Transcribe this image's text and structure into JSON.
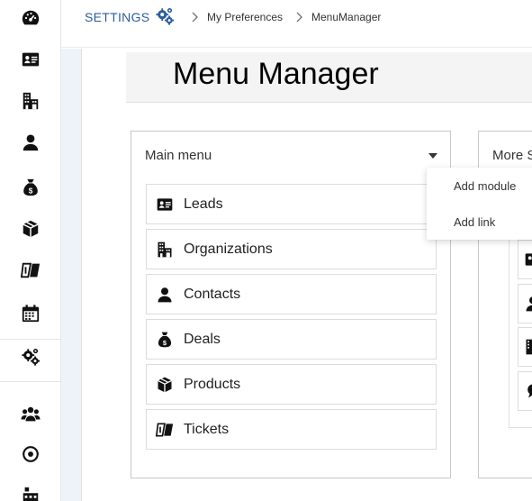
{
  "rail": {
    "items": [
      {
        "name": "dashboard-icon"
      },
      {
        "name": "leads-icon"
      },
      {
        "name": "organizations-icon"
      },
      {
        "name": "contacts-icon"
      },
      {
        "name": "deals-icon"
      },
      {
        "name": "products-icon"
      },
      {
        "name": "tickets-icon"
      },
      {
        "name": "calendar-icon"
      },
      {
        "name": "settings-icon"
      },
      {
        "name": "groups-icon"
      },
      {
        "name": "target-icon"
      },
      {
        "name": "hierarchy-icon"
      }
    ]
  },
  "header": {
    "settings_label": "SETTINGS",
    "breadcrumb": [
      "My Preferences",
      "MenuManager"
    ]
  },
  "page_title": "Menu Manager",
  "main_menu": {
    "title": "Main menu",
    "items": [
      {
        "label": "Leads",
        "icon": "leads-icon"
      },
      {
        "label": "Organizations",
        "icon": "organizations-icon"
      },
      {
        "label": "Contacts",
        "icon": "contacts-icon"
      },
      {
        "label": "Deals",
        "icon": "deals-icon"
      },
      {
        "label": "Products",
        "icon": "products-icon"
      },
      {
        "label": "Tickets",
        "icon": "tickets-icon"
      }
    ]
  },
  "dropdown": {
    "items": [
      "Add module",
      "Add link"
    ]
  },
  "more_section": {
    "title": "More S"
  },
  "colors": {
    "accent": "#2a5d9a",
    "content_bg": "#eef3fa"
  }
}
